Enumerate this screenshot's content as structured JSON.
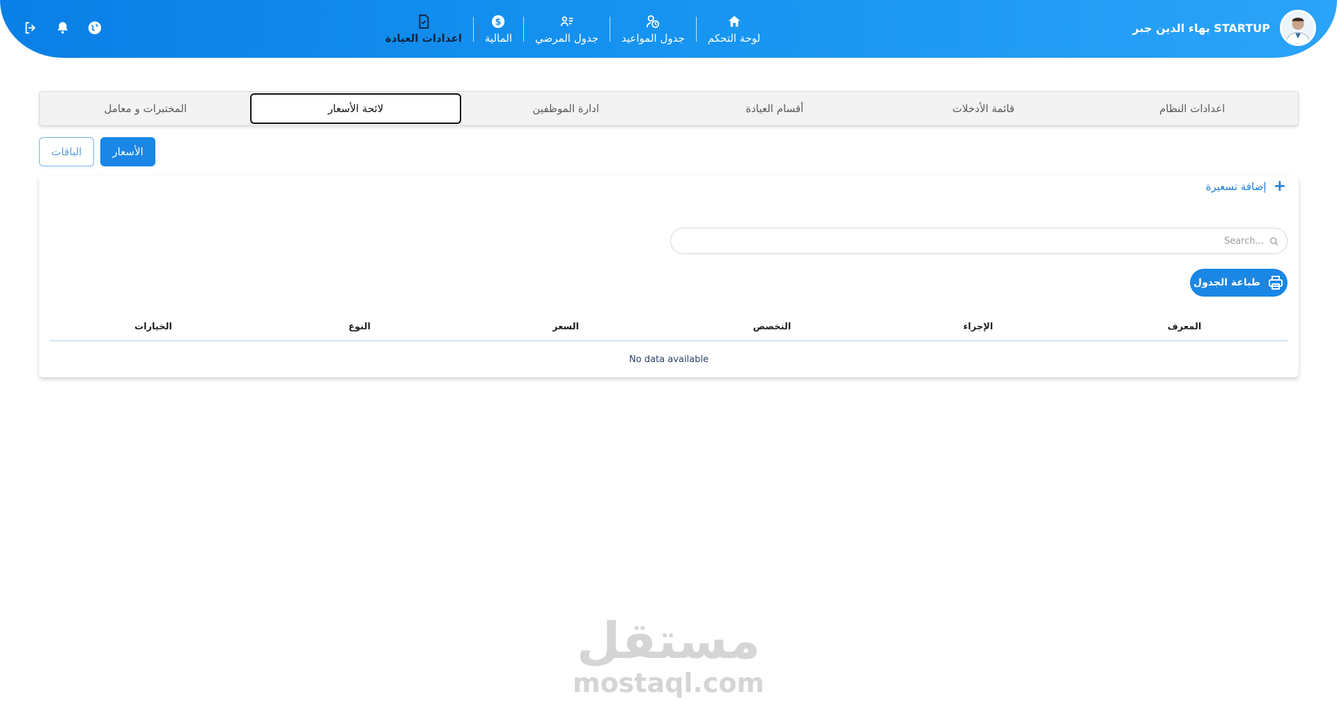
{
  "header": {
    "user_name": "بهاء الدين جبر STARTUP",
    "nav": [
      {
        "label": "لوحة التحكم",
        "icon": "home-icon"
      },
      {
        "label": "جدول المواعيد",
        "icon": "appointments-icon"
      },
      {
        "label": "جدول المرضي",
        "icon": "patients-list-icon"
      },
      {
        "label": "المالية",
        "icon": "dollar-icon"
      },
      {
        "label": "اعدادات العيادة",
        "icon": "clinic-settings-icon"
      }
    ],
    "icons": [
      "logout-icon",
      "bell-icon",
      "globe-icon"
    ]
  },
  "tabs": [
    {
      "label": "اعدادات النظام"
    },
    {
      "label": "قائمة الأدخلات"
    },
    {
      "label": "أقسام العيادة"
    },
    {
      "label": "ادارة الموظفين"
    },
    {
      "label": "لائحة الأسعار"
    },
    {
      "label": "المختبرات و معامل"
    }
  ],
  "active_tab": "لائحة الأسعار",
  "segments": {
    "prices": "الأسعار",
    "packages": "الباقات"
  },
  "card": {
    "add_label": "إضافة تسعيرة",
    "search_placeholder": "Search...",
    "print_label": "طباعة الجدول",
    "columns": [
      "المعرف",
      "الإجراء",
      "التخصص",
      "السعر",
      "النوع",
      "الخيارات"
    ],
    "empty_text": "No data available"
  },
  "watermark": {
    "arabic": "مستقل",
    "latin": "mostaql.com"
  },
  "colors": {
    "primary": "#1a86e6",
    "header_start": "#0a7fe6",
    "header_end": "#2aa3f8"
  }
}
